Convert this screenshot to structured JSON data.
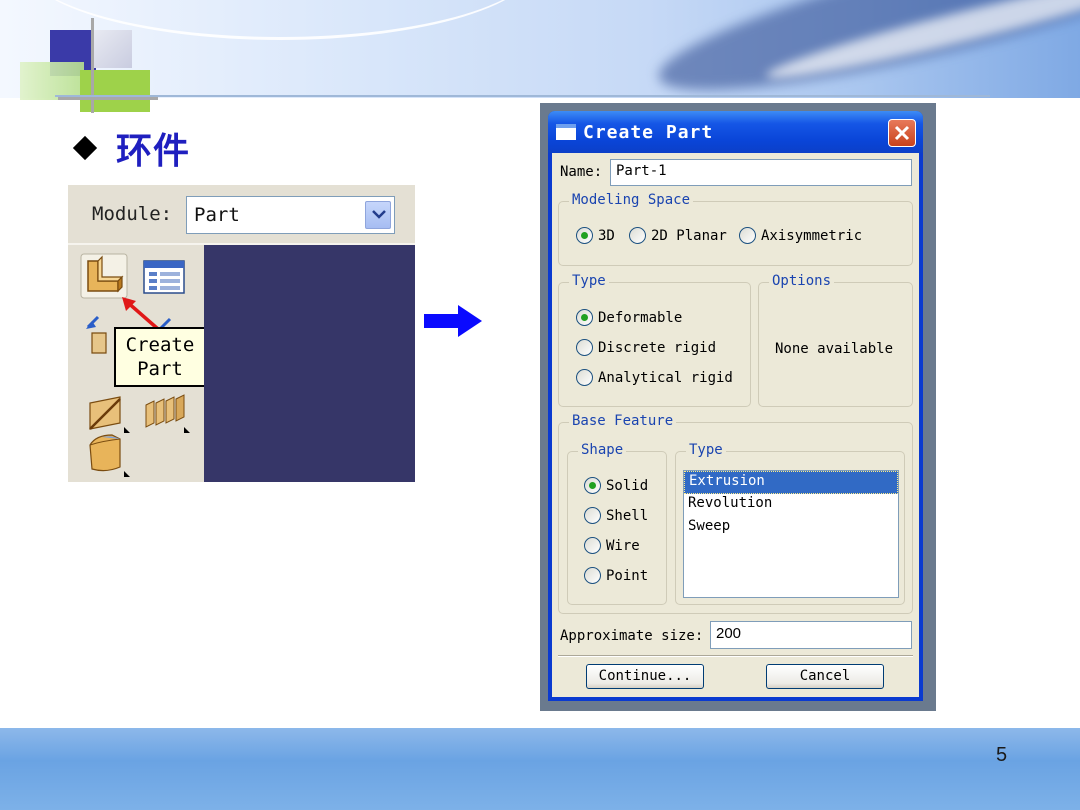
{
  "slide": {
    "heading": "环件",
    "page_number": "5"
  },
  "screenshot": {
    "module_label": "Module:",
    "module_value": "Part",
    "tooltip_line1": "Create",
    "tooltip_line2": "Part"
  },
  "dialog": {
    "title": "Create Part",
    "name_label": "Name:",
    "name_value": "Part-1",
    "modeling_space": {
      "legend": "Modeling Space",
      "options": [
        "3D",
        "2D Planar",
        "Axisymmetric"
      ],
      "selected": "3D"
    },
    "type": {
      "legend": "Type",
      "options": [
        "Deformable",
        "Discrete rigid",
        "Analytical rigid"
      ],
      "selected": "Deformable"
    },
    "options": {
      "legend": "Options",
      "text": "None available"
    },
    "base_feature": {
      "legend": "Base Feature",
      "shape_legend": "Shape",
      "shape_options": [
        "Solid",
        "Shell",
        "Wire",
        "Point"
      ],
      "shape_selected": "Solid",
      "type_legend": "Type",
      "type_items": [
        "Extrusion",
        "Revolution",
        "Sweep"
      ],
      "type_selected": "Extrusion"
    },
    "approx_size_label": "Approximate size:",
    "approx_size_value": "200",
    "continue_label": "Continue...",
    "cancel_label": "Cancel"
  },
  "colors": {
    "heading": "#1f1fbf",
    "viewport": "#363668",
    "titlebar": "#0a45d8",
    "arrow": "#0a0aff"
  }
}
